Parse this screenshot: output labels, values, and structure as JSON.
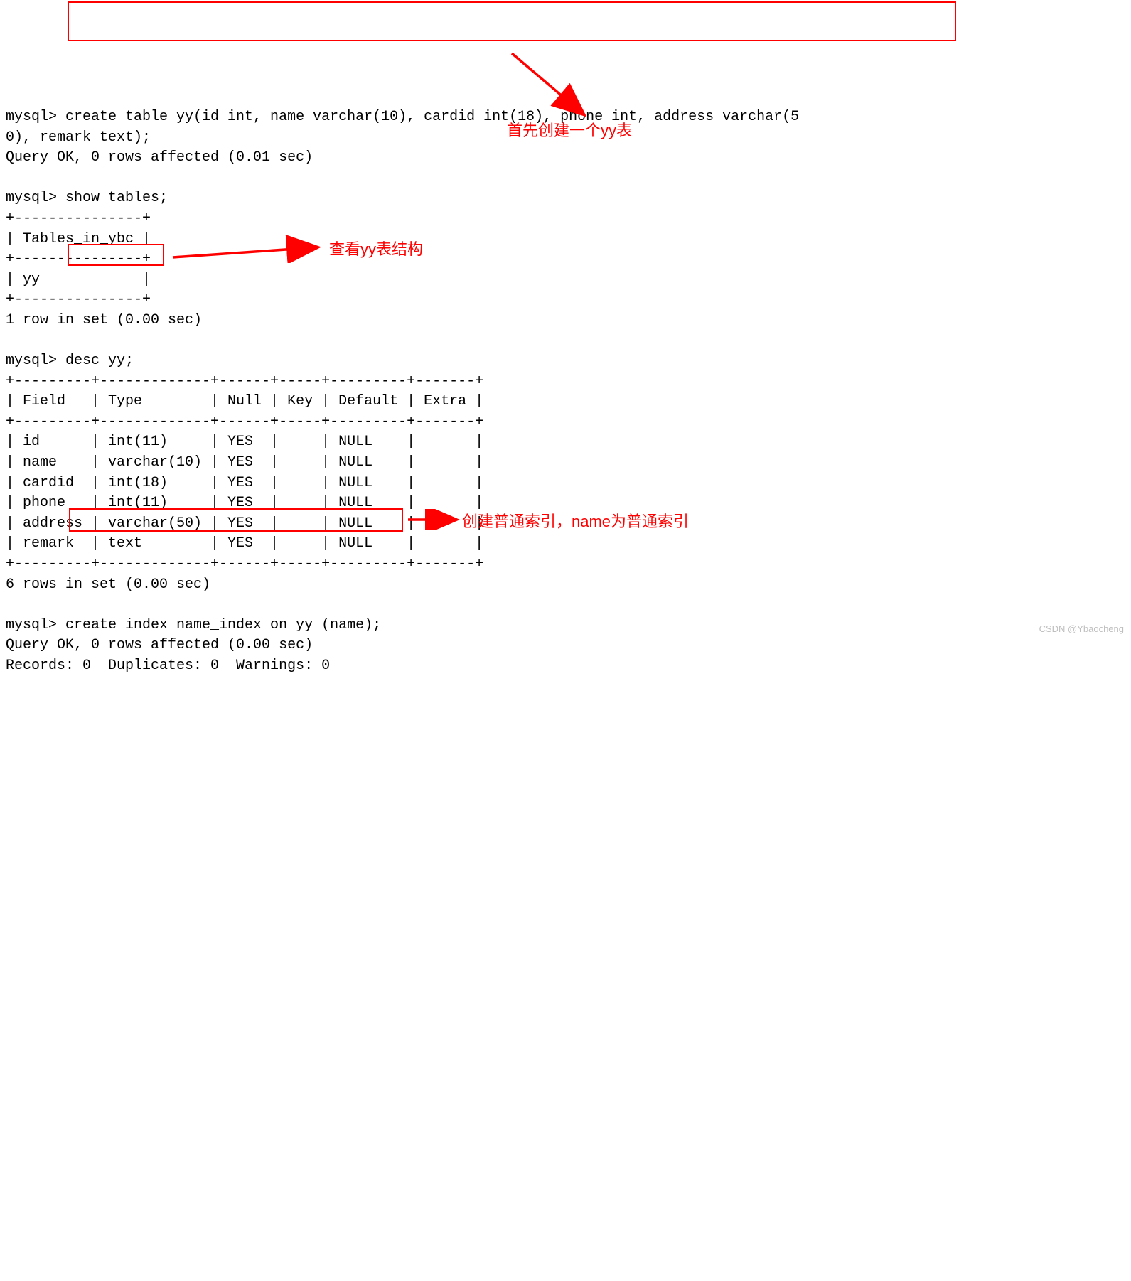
{
  "terminal": {
    "lines": [
      "mysql> create table yy(id int, name varchar(10), cardid int(18), phone int, address varchar(5",
      "0), remark text);",
      "Query OK, 0 rows affected (0.01 sec)",
      "",
      "mysql> show tables;",
      "+---------------+",
      "| Tables_in_ybc |",
      "+---------------+",
      "| yy            |",
      "+---------------+",
      "1 row in set (0.00 sec)",
      "",
      "mysql> desc yy;",
      "+---------+-------------+------+-----+---------+-------+",
      "| Field   | Type        | Null | Key | Default | Extra |",
      "+---------+-------------+------+-----+---------+-------+",
      "| id      | int(11)     | YES  |     | NULL    |       |",
      "| name    | varchar(10) | YES  |     | NULL    |       |",
      "| cardid  | int(18)     | YES  |     | NULL    |       |",
      "| phone   | int(11)     | YES  |     | NULL    |       |",
      "| address | varchar(50) | YES  |     | NULL    |       |",
      "| remark  | text        | YES  |     | NULL    |       |",
      "+---------+-------------+------+-----+---------+-------+",
      "6 rows in set (0.00 sec)",
      "",
      "mysql> create index name_index on yy (name);",
      "Query OK, 0 rows affected (0.00 sec)",
      "Records: 0  Duplicates: 0  Warnings: 0"
    ]
  },
  "annotations": {
    "a1": "首先创建一个yy表",
    "a2": "查看yy表结构",
    "a3": "创建普通索引，name为普通索引"
  },
  "watermark": "CSDN @Ybaocheng"
}
